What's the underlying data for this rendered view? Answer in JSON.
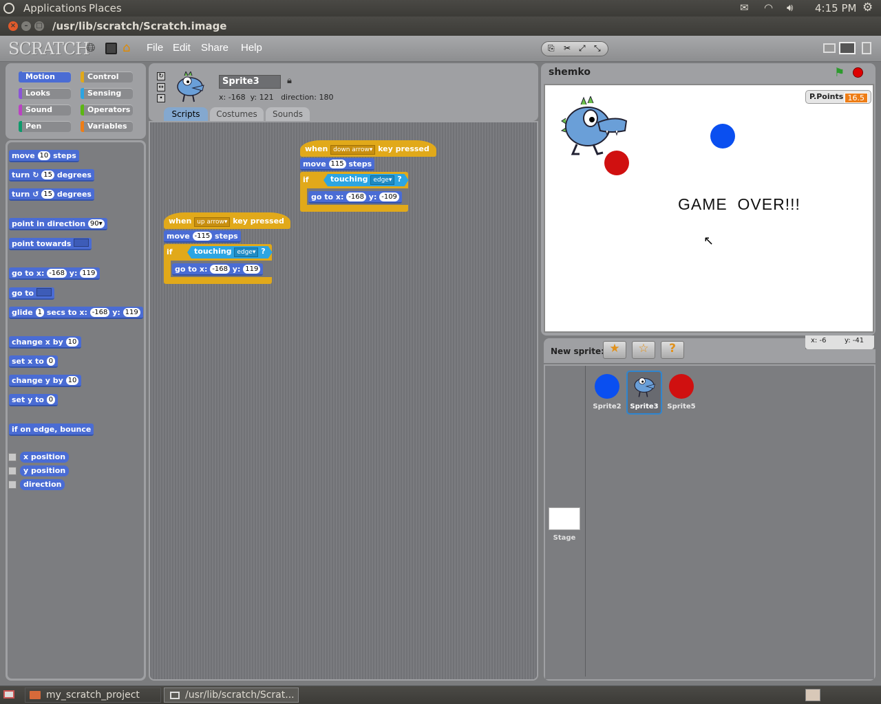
{
  "top_panel": {
    "applications": "Applications",
    "places": "Places",
    "time": "4:15 PM"
  },
  "window": {
    "title": "/usr/lib/scratch/Scratch.image"
  },
  "menu": {
    "logo": "SCRATCH",
    "file": "File",
    "edit": "Edit",
    "share": "Share",
    "help": "Help"
  },
  "categories": {
    "motion": "Motion",
    "control": "Control",
    "looks": "Looks",
    "sensing": "Sensing",
    "sound": "Sound",
    "operators": "Operators",
    "pen": "Pen",
    "variables": "Variables"
  },
  "palette": {
    "move": "move",
    "move_val": "10",
    "steps": "steps",
    "turn": "turn",
    "turn_r_val": "15",
    "turn_l_val": "15",
    "degrees": "degrees",
    "point_dir": "point in direction",
    "point_dir_val": "90",
    "point_towards": "point towards",
    "goto_xy": "go to x:",
    "goto_x": "-168",
    "y_label": "y:",
    "goto_y": "119",
    "goto": "go to",
    "glide": "glide",
    "glide_secs": "1",
    "secs_to_x": "secs to x:",
    "glide_x": "-168",
    "glide_y": "119",
    "change_x": "change x by",
    "change_x_val": "10",
    "set_x": "set x to",
    "set_x_val": "0",
    "change_y": "change y by",
    "change_y_val": "10",
    "set_y": "set y to",
    "set_y_val": "0",
    "bounce": "if on edge, bounce",
    "x_position": "x position",
    "y_position": "y position",
    "direction": "direction"
  },
  "sprite_info": {
    "name": "Sprite3",
    "coords": "x: -168  y: 121   direction: 180"
  },
  "tabs": {
    "scripts": "Scripts",
    "costumes": "Costumes",
    "sounds": "Sounds"
  },
  "script1": {
    "when": "when",
    "key": "down arrow",
    "key_pressed": "key pressed",
    "move": "move",
    "move_val": "115",
    "steps": "steps",
    "if": "if",
    "touching": "touching",
    "edge": "edge",
    "q": "?",
    "goto": "go to x:",
    "x": "-168",
    "y_label": "y:",
    "y": "-109"
  },
  "script2": {
    "when": "when",
    "key": "up arrow",
    "key_pressed": "key pressed",
    "move": "move",
    "move_val": "-115",
    "steps": "steps",
    "if": "if",
    "touching": "touching",
    "edge": "edge",
    "q": "?",
    "goto": "go to x:",
    "x": "-168",
    "y_label": "y:",
    "y": "119"
  },
  "stage": {
    "title": "shemko",
    "game_over": "GAME  OVER!!!",
    "var_name": "P.Points",
    "var_value": "16.5",
    "mouse_x": "x: -6",
    "mouse_y": "y: -41"
  },
  "new_sprite": {
    "label": "New sprite:"
  },
  "sprites": [
    {
      "name": "Sprite2"
    },
    {
      "name": "Sprite3"
    },
    {
      "name": "Sprite5"
    }
  ],
  "stage_thumb": {
    "label": "Stage"
  },
  "taskbar": {
    "item1": "my_scratch_project",
    "item2": "/usr/lib/scratch/Scrat..."
  }
}
